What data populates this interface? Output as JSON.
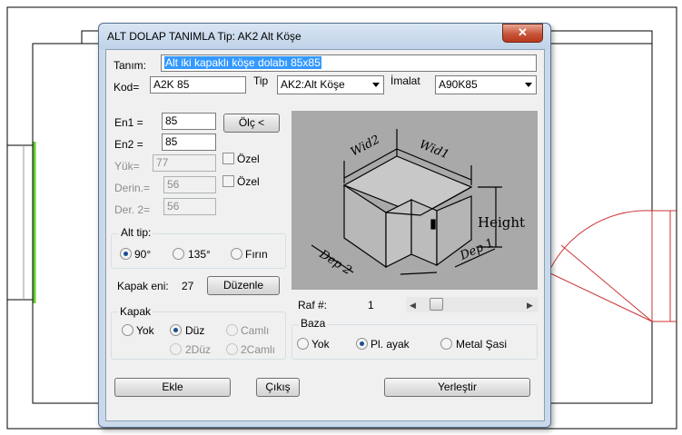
{
  "dialog": {
    "title": "ALT DOLAP TANIMLA Tip: AK2 Alt Köşe",
    "close_label": "✕"
  },
  "form": {
    "tanim_label": "Tanım:",
    "tanim_value": "Alt iki kapaklı köşe dolabı 85x85",
    "kod_label": "Kod=",
    "kod_value": "A2K 85",
    "tip_label": "Tip",
    "tip_value": "AK2:Alt Köşe",
    "imalat_label": "İmalat",
    "imalat_value": "A90K85",
    "en1_label": "En1  =",
    "en1_value": "85",
    "en2_label": "En2  =",
    "en2_value": "85",
    "yuk_label": "Yük=",
    "yuk_value": "77",
    "derin_label": "Derin.=",
    "derin_value": "56",
    "der2_label": "Der. 2=",
    "der2_value": "56",
    "olc_button": "Ölç <",
    "ozel_1": "Özel",
    "ozel_2": "Özel"
  },
  "alt_tip": {
    "title": "Alt tip:",
    "options": [
      "90°",
      "135°",
      "Fırın"
    ],
    "selected": "90°"
  },
  "kapak_eni": {
    "label": "Kapak eni:",
    "value": "27",
    "button": "Düzenle"
  },
  "kapak": {
    "title": "Kapak",
    "options": [
      "Yok",
      "Düz",
      "Camlı",
      "2Düz",
      "2Camlı"
    ],
    "selected": "Düz"
  },
  "raf": {
    "label": "Raf #:",
    "value": "1"
  },
  "baza": {
    "title": "Baza",
    "options": [
      "Yok",
      "Pl. ayak",
      "Metal Şasi"
    ],
    "selected": "Pl. ayak"
  },
  "preview_labels": {
    "wid2": "Wid2",
    "wid1": "Wid1",
    "height": "Height",
    "dep2": "Dep 2",
    "dep1": "Dep 1"
  },
  "buttons": {
    "ekle": "Ekle",
    "cikis": "Çıkış",
    "yerlestir": "Yerleştir"
  },
  "colors": {
    "selection": "#3399ff",
    "radio_dot": "#1b4f91",
    "cad_green": "#66cc33",
    "cad_red": "#cc3333",
    "close_red": "#c7553a"
  }
}
